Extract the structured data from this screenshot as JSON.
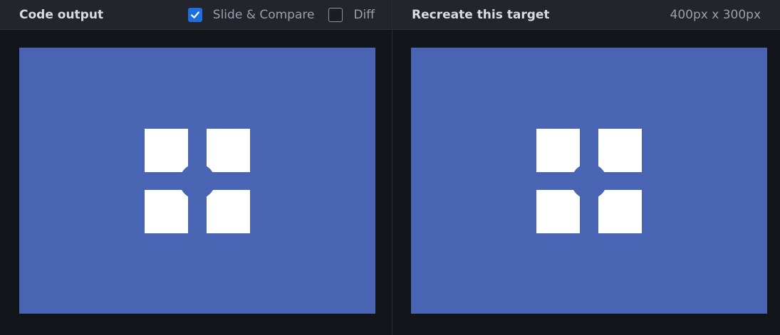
{
  "left_panel": {
    "title": "Code output",
    "slide_compare": {
      "label": "Slide & Compare",
      "checked": true
    },
    "diff": {
      "label": "Diff",
      "checked": false
    },
    "canvas_color": "#4864b3"
  },
  "right_panel": {
    "title": "Recreate this target",
    "size_readout": "400px x 300px",
    "canvas_color": "#4864b3"
  },
  "colors": {
    "accent": "#1d6fe0",
    "canvas": "#4864b3",
    "shape": "#ffffff"
  }
}
